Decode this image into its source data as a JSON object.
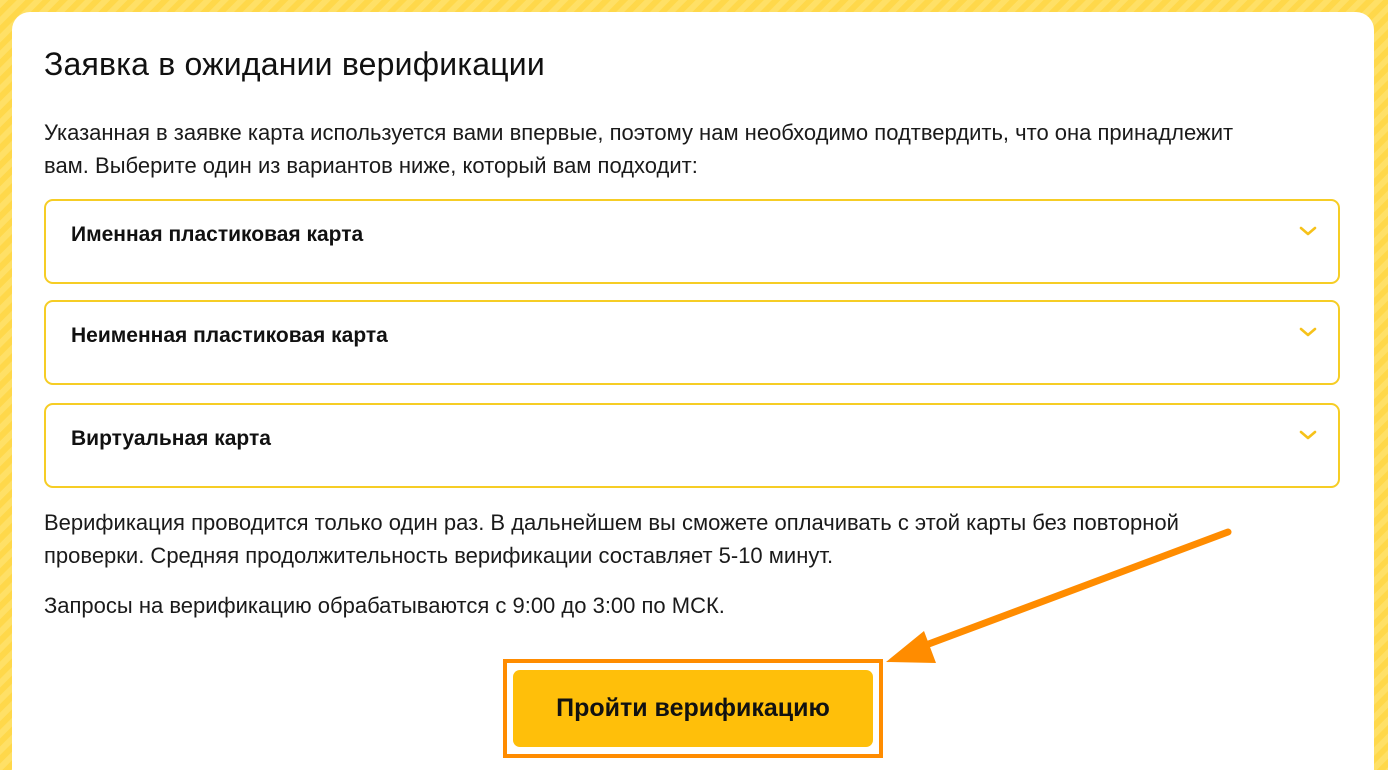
{
  "page": {
    "title": "Заявка в ожидании верификации",
    "intro": "Указанная в заявке карта используется вами впервые, поэтому нам необходимо подтвердить, что она принадлежит вам. Выберите один из вариантов ниже, который вам подходит:",
    "options": [
      {
        "label": "Именная пластиковая карта",
        "icon": "chevron-down-icon"
      },
      {
        "label": "Неименная пластиковая карта",
        "icon": "chevron-down-icon"
      },
      {
        "label": "Виртуальная карта",
        "icon": "chevron-down-icon"
      }
    ],
    "note": "Верификация проводится только один раз. В дальнейшем вы сможете оплачивать с этой карты без повторной проверки. Средняя продолжительность верификации составляет 5-10 минут.",
    "hours": "Запросы на верификацию обрабатываются с 9:00 до 3:00 по МСК.",
    "verify_button": "Пройти верификацию"
  },
  "colors": {
    "accent": "#ffbf0a",
    "border": "#f6cd25",
    "highlight": "#ff8c00",
    "background": "#ffe066"
  }
}
